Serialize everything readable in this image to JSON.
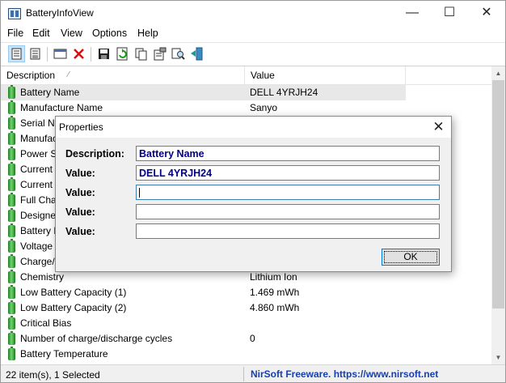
{
  "window": {
    "title": "BatteryInfoView",
    "controls": [
      "—",
      "☐",
      "✕"
    ]
  },
  "menu": [
    "File",
    "Edit",
    "View",
    "Options",
    "Help"
  ],
  "toolbar": [
    "view-properties",
    "html-report",
    "select-all",
    "delete",
    "save",
    "refresh",
    "copy",
    "properties",
    "find",
    "exit"
  ],
  "list": {
    "columns": [
      "Description",
      "Value"
    ],
    "sort_indicator": "⁄",
    "rows": [
      {
        "description": "Battery Name",
        "value": "DELL 4YRJH24",
        "selected": true
      },
      {
        "description": "Manufacture Name",
        "value": "Sanyo"
      },
      {
        "description": "Serial Nu",
        "value": ""
      },
      {
        "description": "Manufac",
        "value": ""
      },
      {
        "description": "Power St",
        "value": ""
      },
      {
        "description": "Current",
        "value": ""
      },
      {
        "description": "Current",
        "value": ""
      },
      {
        "description": "Full Cha",
        "value": ""
      },
      {
        "description": "Designed",
        "value": ""
      },
      {
        "description": "Battery H",
        "value": ""
      },
      {
        "description": "Voltage",
        "value": ""
      },
      {
        "description": "Charge/I",
        "value": ""
      },
      {
        "description": "Chemistry",
        "value": "Lithium Ion"
      },
      {
        "description": "Low Battery Capacity (1)",
        "value": "1.469 mWh"
      },
      {
        "description": "Low Battery Capacity (2)",
        "value": "4.860 mWh"
      },
      {
        "description": "Critical Bias",
        "value": ""
      },
      {
        "description": "Number of charge/discharge cycles",
        "value": "0"
      },
      {
        "description": "Battery Temperature",
        "value": ""
      }
    ]
  },
  "status": {
    "left": "22 item(s), 1 Selected",
    "right": "NirSoft Freeware. https://www.nirsoft.net"
  },
  "dialog": {
    "title": "Properties",
    "close": "✕",
    "fields": [
      {
        "label": "Description:",
        "value": "Battery Name"
      },
      {
        "label": "Value:",
        "value": "DELL 4YRJH24"
      },
      {
        "label": "Value:",
        "value": ""
      },
      {
        "label": "Value:",
        "value": ""
      },
      {
        "label": "Value:",
        "value": ""
      }
    ],
    "ok_label": "OK"
  },
  "colors": {
    "accent": "#0078d7",
    "link": "#1740b0",
    "field_text": "#00008b",
    "battery": "#2e9a2e"
  }
}
